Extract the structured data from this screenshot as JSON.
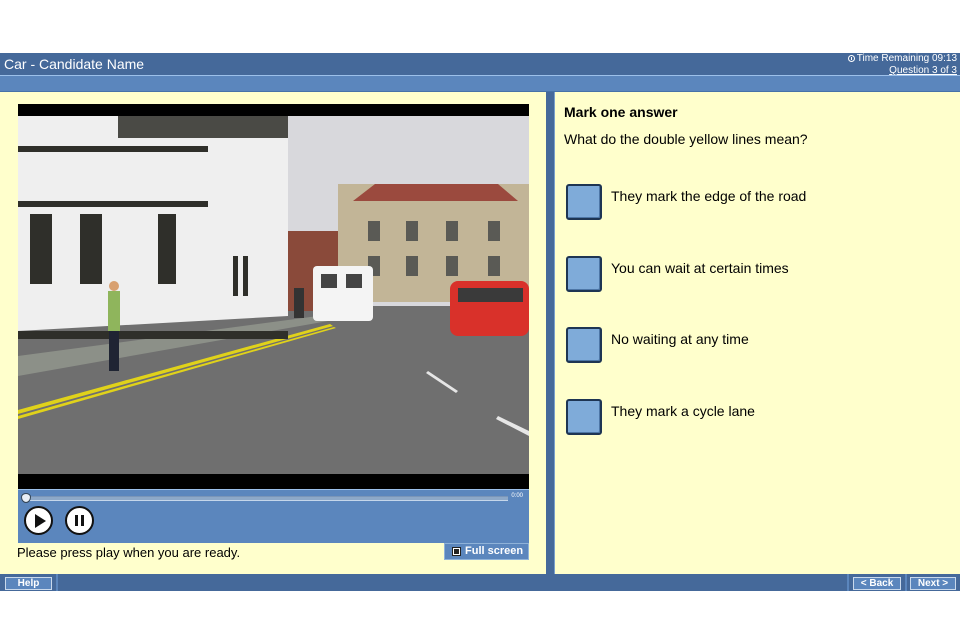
{
  "header": {
    "app_title": "Car - Candidate Name",
    "time_remaining": "Time Remaining 09:13",
    "question_counter": "Question 3 of 3",
    "clock_icon": "clock-icon"
  },
  "video": {
    "description": "Driving clip: street with white Tudor-style building, double yellow lines, white van and red car",
    "timecode": "0:00",
    "progress": 0,
    "play_icon": "play-icon",
    "pause_icon": "pause-icon",
    "hint": "Please press play when you are ready.",
    "fullscreen_label": "Full screen",
    "fullscreen_icon": "fullscreen-icon"
  },
  "question": {
    "instruction": "Mark one answer",
    "text": "What do the double yellow lines mean?",
    "answers": [
      {
        "label": "They mark the edge of the road",
        "selected": false
      },
      {
        "label": "You can wait at certain times",
        "selected": false
      },
      {
        "label": "No waiting at any time",
        "selected": false
      },
      {
        "label": "They mark a cycle lane",
        "selected": false
      }
    ]
  },
  "footer": {
    "help_label": "Help",
    "back_label": "< Back",
    "next_label": "Next >"
  },
  "colors": {
    "header_blue": "#45699a",
    "bar_blue": "#5b86bd",
    "background_yellow": "#ffffcc",
    "answer_box": "#7fabd9"
  }
}
